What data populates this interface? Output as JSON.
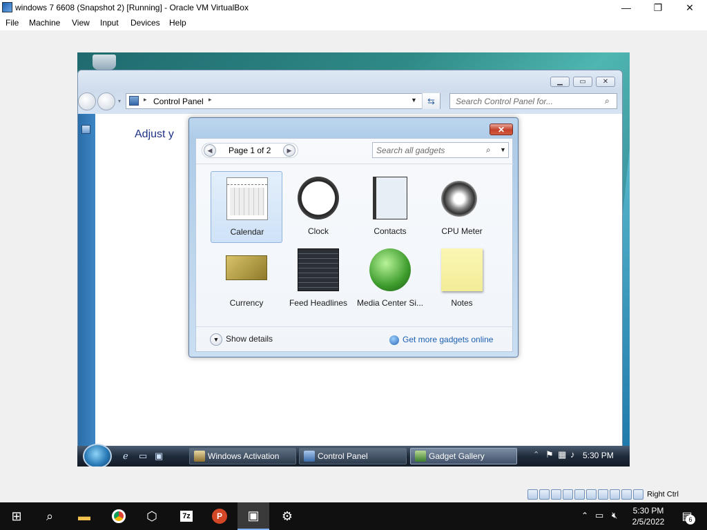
{
  "vbox": {
    "title": "windows 7 6608 (Snapshot 2) [Running] - Oracle VM VirtualBox",
    "menu": [
      "File",
      "Machine",
      "View",
      "Input",
      "Devices",
      "Help"
    ],
    "status_label": "Right Ctrl"
  },
  "explorer": {
    "address": "Control Panel",
    "search_placeholder": "Search Control Panel for...",
    "heading": "Adjust y"
  },
  "gallery": {
    "pager": "Page 1 of 2",
    "search_placeholder": "Search all gadgets",
    "gadgets": [
      {
        "label": "Calendar",
        "icon": "calendar-icon",
        "selected": true
      },
      {
        "label": "Clock",
        "icon": "clock-icon"
      },
      {
        "label": "Contacts",
        "icon": "contacts-icon"
      },
      {
        "label": "CPU Meter",
        "icon": "cpu-meter-icon"
      },
      {
        "label": "Currency",
        "icon": "currency-icon"
      },
      {
        "label": "Feed Headlines",
        "icon": "feed-headlines-icon"
      },
      {
        "label": "Media Center Si...",
        "icon": "media-center-icon"
      },
      {
        "label": "Notes",
        "icon": "notes-icon"
      }
    ],
    "show_details": "Show details",
    "get_more": "Get more gadgets online"
  },
  "guest_taskbar": {
    "buttons": [
      {
        "label": "Windows Activation",
        "active": false
      },
      {
        "label": "Control Panel",
        "active": false
      },
      {
        "label": "Gadget Gallery",
        "active": true
      }
    ],
    "time": "5:30 PM"
  },
  "host_taskbar": {
    "time": "5:30 PM",
    "date": "2/5/2022",
    "notification_count": "6"
  }
}
